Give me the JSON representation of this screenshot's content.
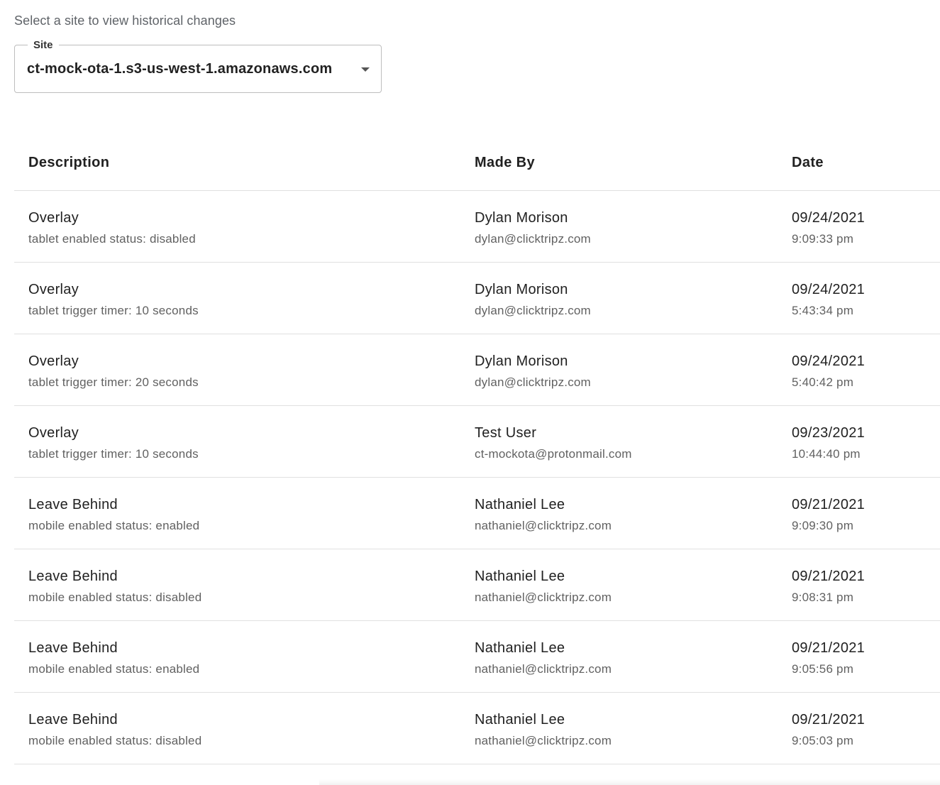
{
  "intro_text": "Select a site to view historical changes",
  "site_select": {
    "label": "Site",
    "value": "ct-mock-ota-1.s3-us-west-1.amazonaws.com"
  },
  "table": {
    "headers": {
      "description": "Description",
      "made_by": "Made By",
      "date": "Date"
    },
    "rows": [
      {
        "title": "Overlay",
        "detail": "tablet enabled status: disabled",
        "name": "Dylan Morison",
        "email": "dylan@clicktripz.com",
        "date": "09/24/2021",
        "time": "9:09:33 pm"
      },
      {
        "title": "Overlay",
        "detail": "tablet trigger timer: 10 seconds",
        "name": "Dylan Morison",
        "email": "dylan@clicktripz.com",
        "date": "09/24/2021",
        "time": "5:43:34 pm"
      },
      {
        "title": "Overlay",
        "detail": "tablet trigger timer: 20 seconds",
        "name": "Dylan Morison",
        "email": "dylan@clicktripz.com",
        "date": "09/24/2021",
        "time": "5:40:42 pm"
      },
      {
        "title": "Overlay",
        "detail": "tablet trigger timer: 10 seconds",
        "name": "Test User",
        "email": "ct-mockota@protonmail.com",
        "date": "09/23/2021",
        "time": "10:44:40 pm"
      },
      {
        "title": "Leave Behind",
        "detail": "mobile enabled status: enabled",
        "name": "Nathaniel Lee",
        "email": "nathaniel@clicktripz.com",
        "date": "09/21/2021",
        "time": "9:09:30 pm"
      },
      {
        "title": "Leave Behind",
        "detail": "mobile enabled status: disabled",
        "name": "Nathaniel Lee",
        "email": "nathaniel@clicktripz.com",
        "date": "09/21/2021",
        "time": "9:08:31 pm"
      },
      {
        "title": "Leave Behind",
        "detail": "mobile enabled status: enabled",
        "name": "Nathaniel Lee",
        "email": "nathaniel@clicktripz.com",
        "date": "09/21/2021",
        "time": "9:05:56 pm"
      },
      {
        "title": "Leave Behind",
        "detail": "mobile enabled status: disabled",
        "name": "Nathaniel Lee",
        "email": "nathaniel@clicktripz.com",
        "date": "09/21/2021",
        "time": "9:05:03 pm"
      }
    ]
  }
}
